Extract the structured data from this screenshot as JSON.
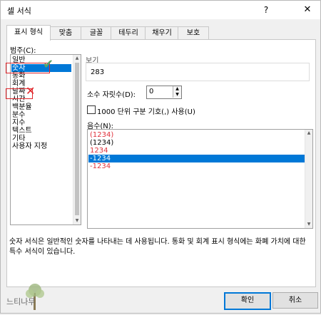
{
  "window": {
    "title": "셀 서식",
    "help": "?",
    "close": "✕"
  },
  "tabs": [
    {
      "label": "표시 형식"
    },
    {
      "label": "맞춤"
    },
    {
      "label": "글꼴"
    },
    {
      "label": "테두리"
    },
    {
      "label": "채우기"
    },
    {
      "label": "보호"
    }
  ],
  "category": {
    "label": "범주(C):",
    "items": [
      "일반",
      "숫자",
      "통화",
      "회계",
      "날짜",
      "시간",
      "백분율",
      "분수",
      "지수",
      "텍스트",
      "기타",
      "사용자 지정"
    ],
    "selected": "숫자"
  },
  "sample": {
    "label": "보기",
    "value": "283"
  },
  "decimal": {
    "label": "소수 자릿수(D):",
    "value": "0"
  },
  "separator": {
    "label": "1000 단위 구분 기호(,) 사용(U)",
    "checked": false
  },
  "negative": {
    "label": "음수(N):",
    "items": [
      {
        "text": "(1234)",
        "color": "#e0303a"
      },
      {
        "text": "(1234)",
        "color": "#000000"
      },
      {
        "text": "1234",
        "color": "#e0303a"
      },
      {
        "text": "-1234",
        "color": "#ffffff"
      },
      {
        "text": "-1234",
        "color": "#e0303a"
      }
    ],
    "selected_index": 3
  },
  "description": "숫자 서식은 일반적인 숫자를 나타내는 데 사용됩니다. 통화 및 회계 표시 형식에는 화폐 가치에 대한 특수 서식이 있습니다.",
  "buttons": {
    "ok": "확인",
    "cancel": "취소"
  },
  "watermark": {
    "text": "느티나무"
  },
  "annotations": {
    "check": "✔",
    "cross": "✕"
  },
  "colors": {
    "accent": "#0078d7",
    "annotation": "#e0252a",
    "check": "#5aa469"
  }
}
